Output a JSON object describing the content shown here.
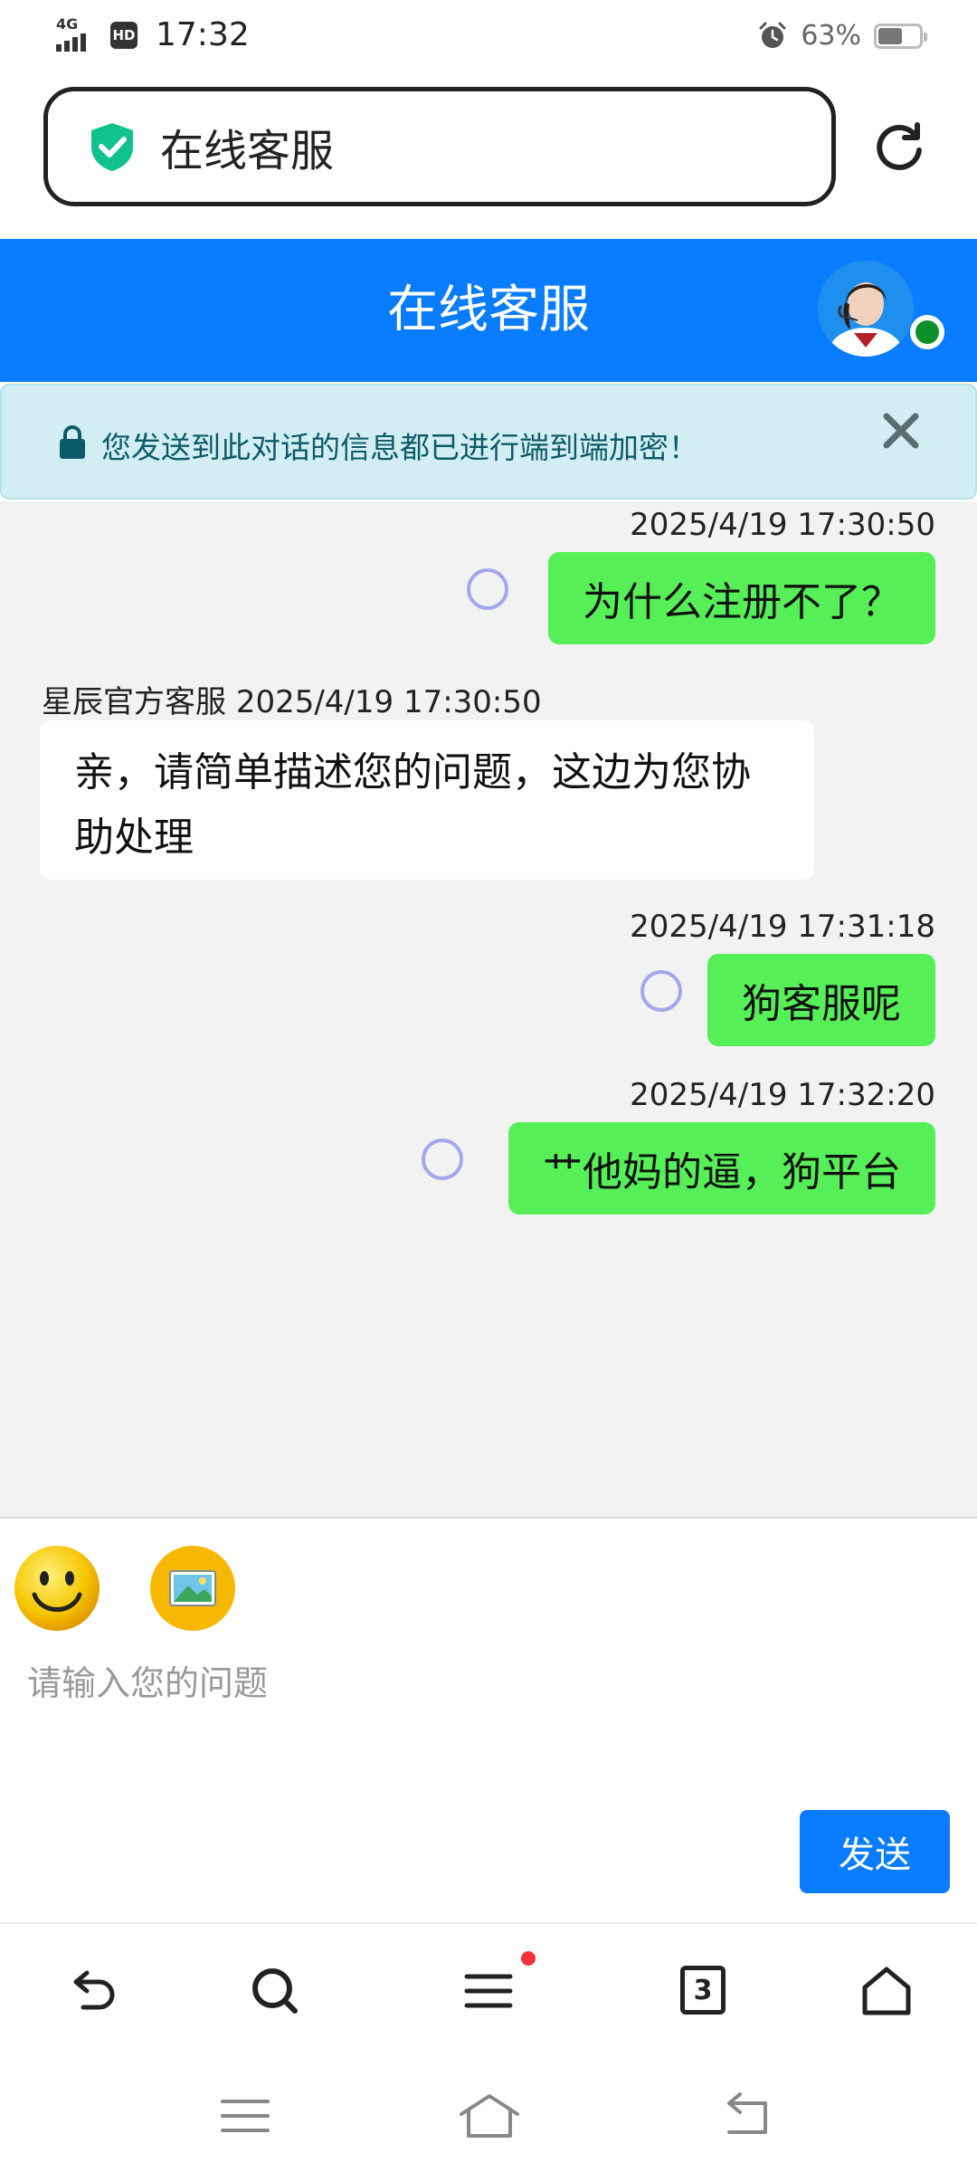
{
  "status_bar": {
    "network": "4G",
    "hd": "HD",
    "time": "17:32",
    "battery_percent": "63%"
  },
  "browser": {
    "address_title": "在线客服"
  },
  "chat_header": {
    "title": "在线客服"
  },
  "notice": {
    "text": "您发送到此对话的信息都已进行端到端加密！"
  },
  "messages": [
    {
      "from": "user",
      "timestamp": "2025/4/19 17:30:50",
      "text": "为什么注册不了？"
    },
    {
      "from": "agent",
      "sender": "星辰官方客服",
      "timestamp": "2025/4/19 17:30:50",
      "text": "亲，请简单描述您的问题，这边为您协助处理"
    },
    {
      "from": "user",
      "timestamp": "2025/4/19 17:31:18",
      "text": "狗客服呢"
    },
    {
      "from": "user",
      "timestamp": "2025/4/19 17:32:20",
      "text": "艹他妈的逼，狗平台"
    }
  ],
  "composer": {
    "placeholder": "请输入您的问题",
    "send_label": "发送"
  },
  "toolbar": {
    "tab_count": "3"
  },
  "colors": {
    "header_blue": "#0a7cff",
    "user_bubble": "#56ef58",
    "agent_bubble": "#ffffff",
    "chat_bg": "#f2f2f2",
    "notice_bg": "#d2eef3",
    "notice_text": "#0c5b6a",
    "online": "#0d8f2c"
  },
  "icons": [
    "signal-icon",
    "hd-icon",
    "alarm-icon",
    "battery-icon",
    "shield-check-icon",
    "refresh-icon",
    "lock-icon",
    "close-icon",
    "emoji-icon",
    "image-icon",
    "back-icon",
    "search-icon",
    "menu-icon",
    "tabs-icon",
    "home-icon"
  ]
}
